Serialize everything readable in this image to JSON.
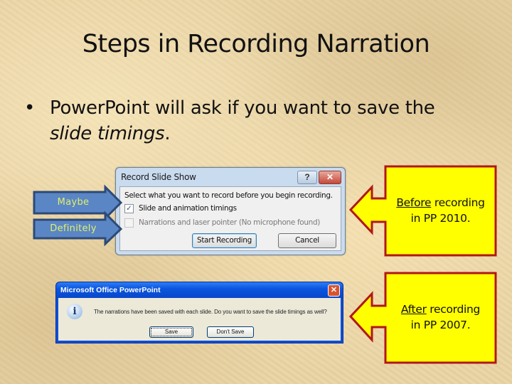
{
  "slide": {
    "title": "Steps in Recording Narration",
    "bullet_icon": "•",
    "bullet_main": "PowerPoint will ask if you want to save the",
    "bullet_italic": "slide timings",
    "bullet_end": "."
  },
  "record_dialog": {
    "title": "Record Slide Show",
    "help_icon": "?",
    "close_icon": "✕",
    "prompt": "Select what you want to record before you begin recording.",
    "options": [
      {
        "label": "Slide and animation timings",
        "checked": true,
        "enabled": true,
        "check_glyph": "✓"
      },
      {
        "label": "Narrations and laser pointer (No microphone found)",
        "checked": false,
        "enabled": false
      }
    ],
    "start_button": "Start Recording",
    "cancel_button": "Cancel"
  },
  "xp_dialog": {
    "title": "Microsoft Office PowerPoint",
    "close_icon": "✕",
    "info_icon": "i",
    "message": "The narrations have been saved with each slide. Do you want to save the slide timings as well?",
    "save_button": "Save",
    "dont_save_button": "Don't Save"
  },
  "arrows": {
    "maybe": "Maybe",
    "definitely": "Definitely"
  },
  "callouts": [
    {
      "emph": "Before",
      "rest": " recording",
      "line2": "in PP 2010."
    },
    {
      "emph": "After",
      "rest": " recording",
      "line2": "in PP 2007."
    }
  ],
  "colors": {
    "arrow_fill": "#5b86c5",
    "arrow_stroke": "#2c4a78",
    "arrow_text": "#dff06a",
    "callout_fill": "#ffff00",
    "callout_stroke": "#b01818"
  }
}
